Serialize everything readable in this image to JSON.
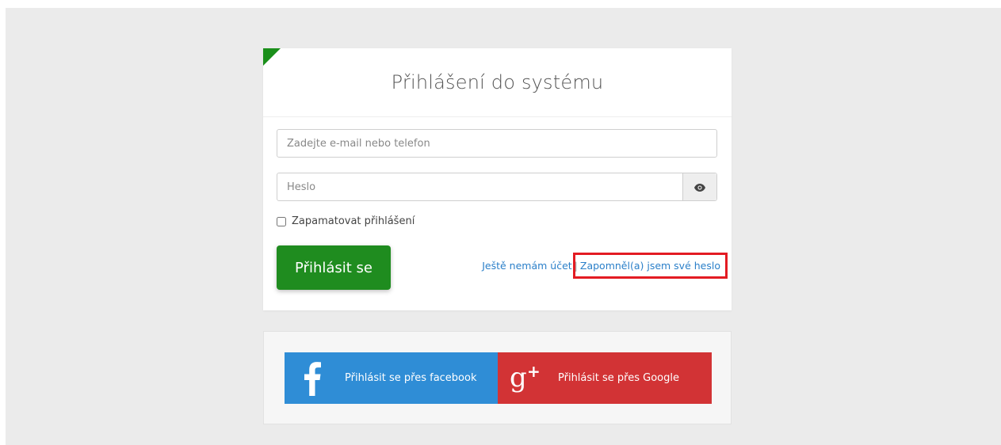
{
  "login": {
    "title": "Přihlášení do systému",
    "email_placeholder": "Zadejte e-mail nebo telefon",
    "password_placeholder": "Heslo",
    "remember_label": "Zapamatovat přihlášení",
    "submit_label": "Přihlásit se",
    "register_link": "Ještě nemám účet",
    "separator": "|",
    "forgot_link": "Zapomněl(a) jsem své heslo"
  },
  "social": {
    "facebook_label": "Přihlásit se přes facebook",
    "google_label": "Přihlásit se přes Google"
  },
  "icons": {
    "password_toggle": "eye-icon",
    "facebook": "facebook-icon",
    "google": "google-plus-icon"
  },
  "colors": {
    "primary_green": "#1f8c1f",
    "link_blue": "#2a7fc9",
    "facebook_blue": "#2f8dd6",
    "google_red": "#d23335",
    "highlight_red": "#e31b23"
  }
}
